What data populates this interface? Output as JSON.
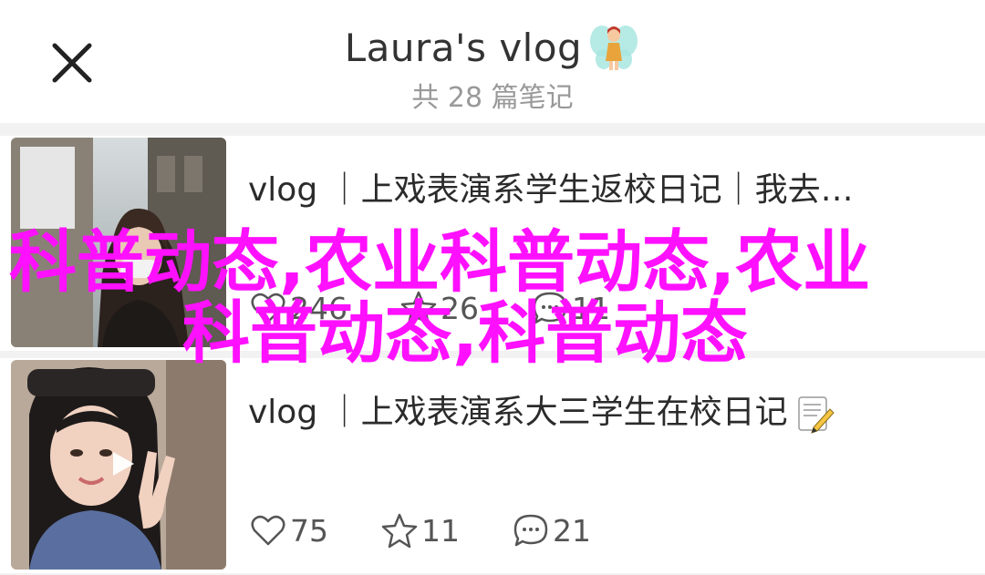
{
  "header": {
    "title": "Laura's vlog",
    "note_count": "共 28 篇笔记"
  },
  "notes": [
    {
      "title": "vlog ｜上戏表演系学生返校日记｜我去…",
      "likes": "246",
      "stars": "26",
      "comments": "11"
    },
    {
      "title": "vlog ｜上戏表演系大三学生在校日记",
      "likes": "75",
      "stars": "11",
      "comments": "21"
    }
  ],
  "watermark": {
    "line1": "科普动态,农业科普动态,农业",
    "line2": "科普动态,科普动态"
  },
  "icons": {
    "close": "close-icon",
    "fairy": "fairy-emoji-icon",
    "like": "heart-icon",
    "star": "star-icon",
    "comment": "comment-bubble-icon",
    "memo": "memo-emoji-icon",
    "play": "play-icon"
  }
}
